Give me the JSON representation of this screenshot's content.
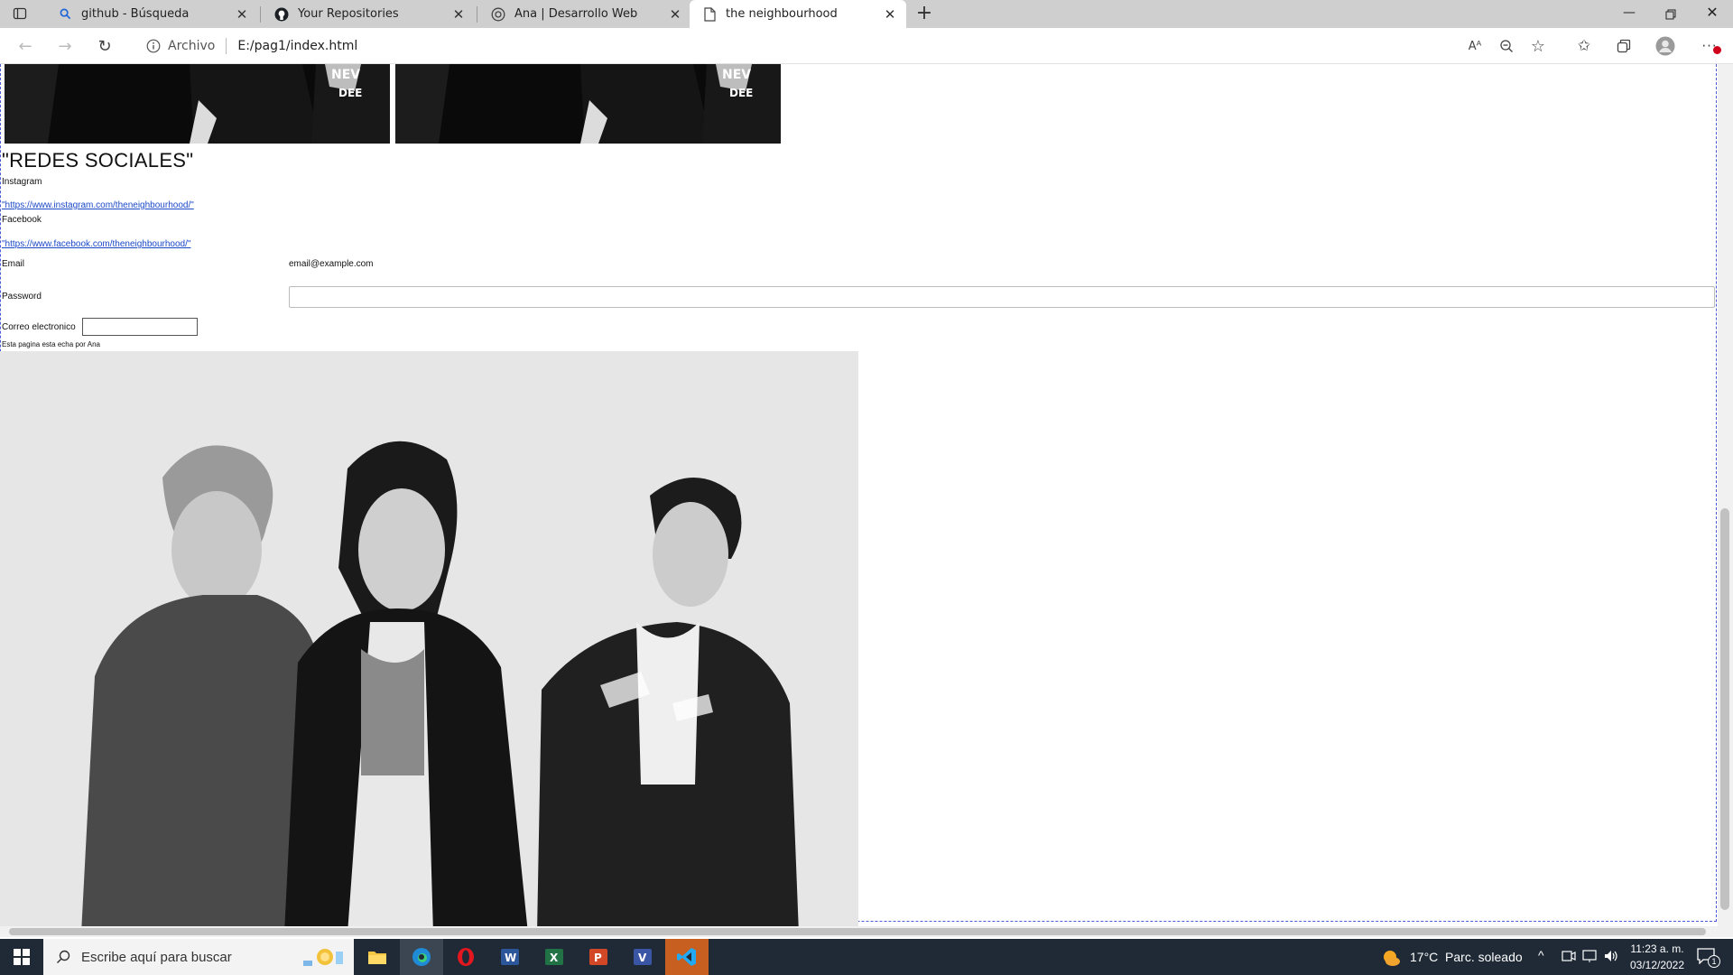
{
  "browser": {
    "tabs": [
      {
        "title": "github - Búsqueda",
        "icon": "search-icon"
      },
      {
        "title": "Your Repositories",
        "icon": "github-icon"
      },
      {
        "title": "Ana | Desarrollo Web",
        "icon": "web-icon"
      },
      {
        "title": "the neighbourhood",
        "icon": "page-icon",
        "active": true
      }
    ],
    "address": {
      "scheme_label": "Archivo",
      "url": "E:/pag1/index.html"
    }
  },
  "page": {
    "heading": "\"REDES SOCIALES\"",
    "instagram_label": "Instagram",
    "instagram_link": "\"https://www.instagram.com/theneighbourhood/\"",
    "facebook_label": "Facebook",
    "facebook_link": "\"https://www.facebook.com/theneighbourhood/\"",
    "email_label": "Email",
    "email_value": "email@example.com",
    "password_label": "Password",
    "correo_label": "Correo electronico",
    "footer_text": "Esta pagina esta echa por Ana"
  },
  "taskbar": {
    "search_placeholder": "Escribe aquí para buscar",
    "weather": "17°C  Parc. soleado",
    "time": "11:23 a. m.",
    "date": "03/12/2022",
    "notification_count": "1"
  }
}
